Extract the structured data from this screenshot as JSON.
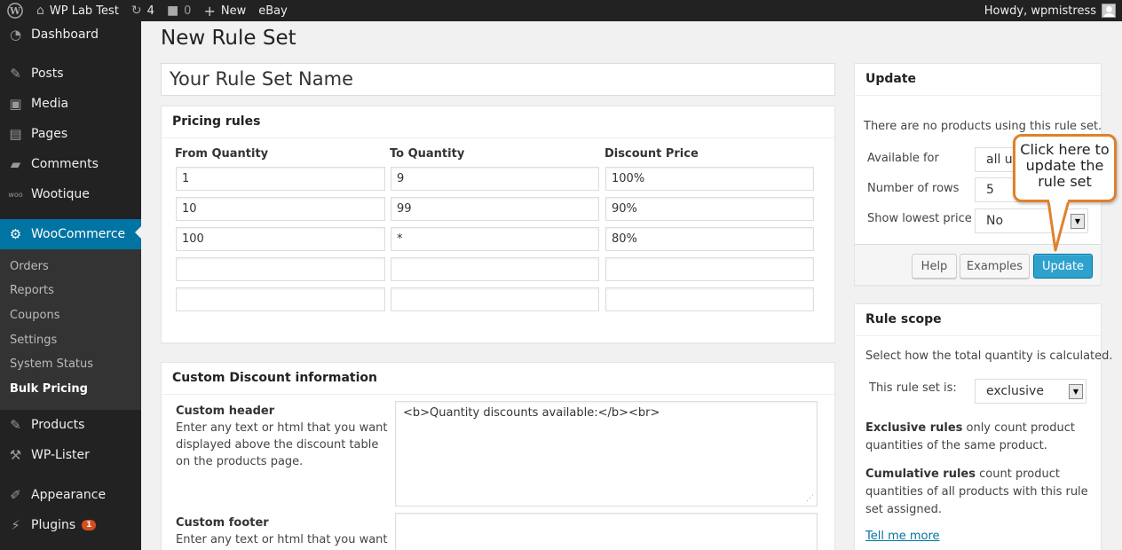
{
  "adminbar": {
    "site_name": "WP Lab Test",
    "updates_count": "4",
    "comments_count": "0",
    "new_label": "New",
    "ebay_label": "eBay",
    "howdy": "Howdy, wpmistress"
  },
  "sidebar": {
    "items": [
      {
        "label": "Dashboard",
        "icon": "dashboard-icon"
      },
      {
        "label": "Posts",
        "icon": "pin-icon"
      },
      {
        "label": "Media",
        "icon": "media-icon"
      },
      {
        "label": "Pages",
        "icon": "pages-icon"
      },
      {
        "label": "Comments",
        "icon": "comment-icon"
      },
      {
        "label": "Wootique",
        "icon": "woo-icon"
      },
      {
        "label": "WooCommerce",
        "icon": "gear-icon"
      },
      {
        "label": "Products",
        "icon": "pin-icon"
      },
      {
        "label": "WP-Lister",
        "icon": "hammer-icon"
      },
      {
        "label": "Appearance",
        "icon": "brush-icon"
      },
      {
        "label": "Plugins",
        "icon": "plug-icon",
        "badge": "1"
      }
    ],
    "submenu": [
      "Orders",
      "Reports",
      "Coupons",
      "Settings",
      "System Status",
      "Bulk Pricing"
    ]
  },
  "main": {
    "page_title": "New Rule Set",
    "rule_set_name": "Your Rule Set Name",
    "pricing": {
      "title": "Pricing rules",
      "columns": [
        "From Quantity",
        "To Quantity",
        "Discount Price"
      ],
      "rows": [
        [
          "1",
          "9",
          "100%"
        ],
        [
          "10",
          "99",
          "90%"
        ],
        [
          "100",
          "*",
          "80%"
        ],
        [
          "",
          "",
          ""
        ],
        [
          "",
          "",
          ""
        ]
      ]
    },
    "custom": {
      "title": "Custom Discount information",
      "header_label": "Custom header",
      "header_desc": "Enter any text or html that you want displayed above the discount table on the products page.",
      "header_value": "<b>Quantity discounts available:</b><br>",
      "footer_label": "Custom footer",
      "footer_desc": "Enter any text or html that you want",
      "footer_value": ""
    }
  },
  "update_box": {
    "title": "Update",
    "notice": "There are no products using this rule set.",
    "available_label": "Available for",
    "available_value": "all us",
    "rows_label": "Number of rows",
    "rows_value": "5",
    "lowest_label": "Show lowest price",
    "lowest_value": "No",
    "help": "Help",
    "examples": "Examples",
    "update": "Update"
  },
  "rule_scope": {
    "title": "Rule scope",
    "intro": "Select how the total quantity is calculated.",
    "label": "This rule set is:",
    "value": "exclusive",
    "exclusive_bold": "Exclusive rules",
    "exclusive_rest": " only count product quantities of the same product.",
    "cumulative_bold": "Cumulative rules",
    "cumulative_rest": " count product quantities of all products with this rule set assigned.",
    "link": "Tell me more"
  },
  "callout": {
    "line1": "Click here to",
    "line2": "update the",
    "line3": "rule set"
  },
  "colors": {
    "adminbar": "#222222",
    "accent": "#0074a2",
    "primary_button": "#2ea2cc",
    "callout_border": "#e0812b",
    "badge": "#d54e21"
  }
}
